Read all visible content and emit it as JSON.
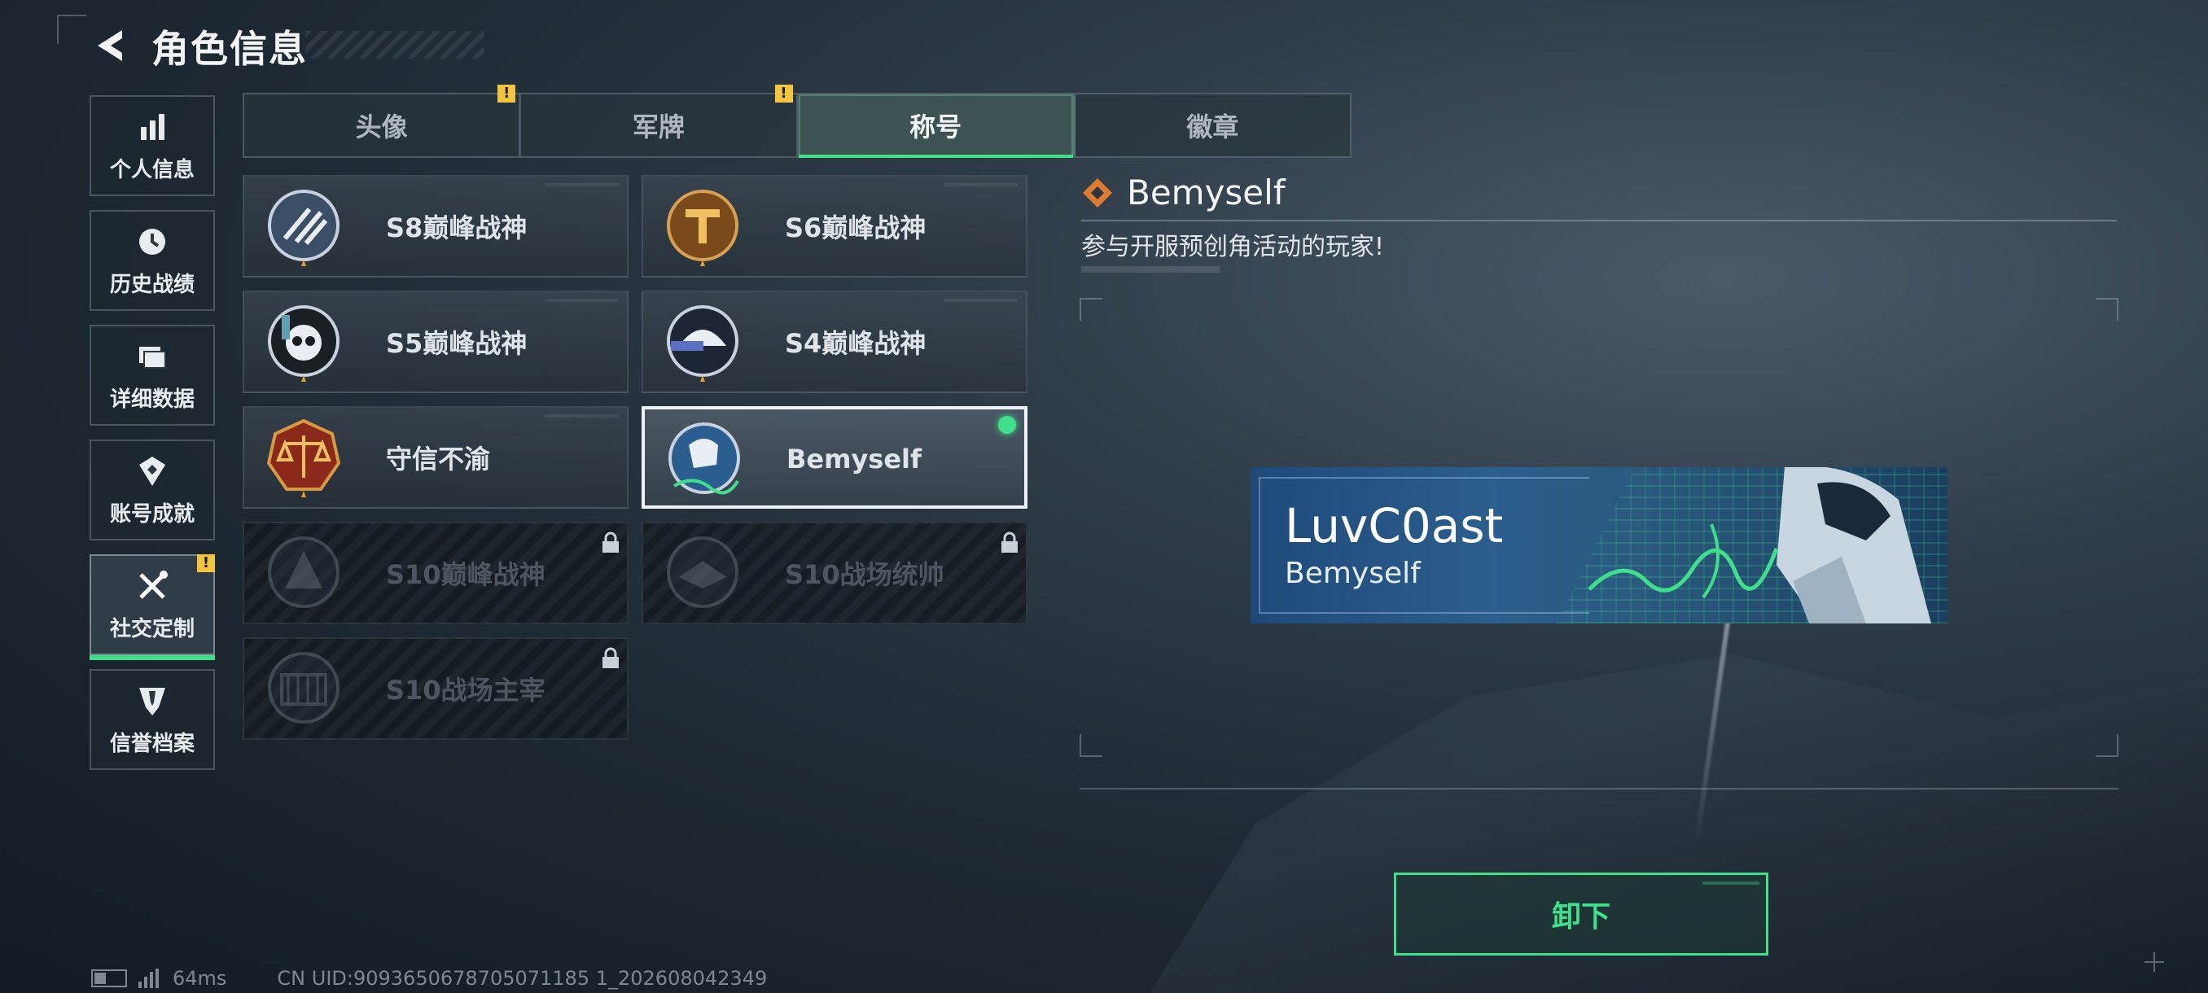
{
  "header": {
    "title": "角色信息"
  },
  "sidebar": {
    "items": [
      {
        "label": "个人信息",
        "icon": "bar-chart-icon"
      },
      {
        "label": "历史战绩",
        "icon": "history-clock-icon"
      },
      {
        "label": "详细数据",
        "icon": "folder-icon"
      },
      {
        "label": "账号成就",
        "icon": "achievement-icon"
      },
      {
        "label": "社交定制",
        "icon": "tools-icon",
        "active": true,
        "alert": "!"
      },
      {
        "label": "信誉档案",
        "icon": "reputation-shield-icon"
      }
    ]
  },
  "tabs": [
    {
      "label": "头像",
      "alert": "!"
    },
    {
      "label": "军牌",
      "alert": "!"
    },
    {
      "label": "称号",
      "active": true
    },
    {
      "label": "徽章"
    }
  ],
  "titles": [
    {
      "name": "S8巅峰战神",
      "state": "owned"
    },
    {
      "name": "S6巅峰战神",
      "state": "owned"
    },
    {
      "name": "S5巅峰战神",
      "state": "owned"
    },
    {
      "name": "S4巅峰战神",
      "state": "owned"
    },
    {
      "name": "守信不渝",
      "state": "owned"
    },
    {
      "name": "Bemyself",
      "state": "equipped"
    },
    {
      "name": "S10巅峰战神",
      "state": "locked"
    },
    {
      "name": "S10战场统帅",
      "state": "locked"
    },
    {
      "name": "S10战场主宰",
      "state": "locked"
    }
  ],
  "detail": {
    "title": "Bemyself",
    "description": "参与开服预创角活动的玩家!",
    "nameplate": {
      "player_name": "LuvC0ast",
      "title": "Bemyself"
    },
    "unequip_label": "卸下"
  },
  "status": {
    "ping": "64ms",
    "uid": "CN UID:9093650678705071185 1_202608042349"
  },
  "colors": {
    "accent": "#3ee08a",
    "warning": "#f2c53d",
    "title_diamond": "#e07a2e"
  }
}
